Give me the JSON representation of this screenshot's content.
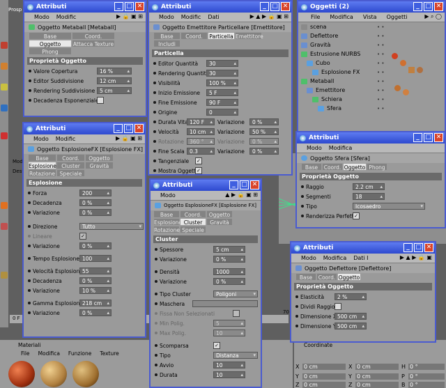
{
  "bg_labels": {
    "top_left": "Prosp",
    "mod": "Mod",
    "des": "Desti",
    "frame_field": "0 F",
    "frame_num": "70"
  },
  "materials": {
    "title": "Materiali",
    "menu": [
      "File",
      "Modifica",
      "Funzione",
      "Texture"
    ]
  },
  "coordinates": {
    "title": "Coordinate",
    "rows": [
      {
        "a": "X",
        "av": "0 cm",
        "b": "X",
        "bv": "0 cm",
        "c": "H",
        "cv": "0 °"
      },
      {
        "a": "Y",
        "av": "0 cm",
        "b": "Y",
        "bv": "0 cm",
        "c": "P",
        "cv": "0 °"
      },
      {
        "a": "Z",
        "av": "0 cm",
        "b": "Z",
        "bv": "0 cm",
        "c": "B",
        "cv": "0 °"
      }
    ]
  },
  "w1": {
    "title": "Attributi",
    "menu": [
      "Modo",
      "Modific"
    ],
    "object": "Oggetto Metaball [Metaball]",
    "tabs": [
      "Base",
      "Coord.",
      "Oggetto",
      "Attacca Texture",
      "Phong"
    ],
    "section": "Proprietà Oggetto",
    "rows": [
      {
        "label": "Valore Copertura",
        "value": "16 %"
      },
      {
        "label": "Editor Suddivisione",
        "value": "12 cm"
      },
      {
        "label": "Rendering Suddivisione",
        "value": "5 cm"
      },
      {
        "label": "Decadenza Esponenziale"
      }
    ]
  },
  "w2": {
    "title": "Attributi",
    "menu": [
      "Modo",
      "Modific",
      "Dati"
    ],
    "object": "Oggetto Emettitore Particellare [Emettitore]",
    "tabs": [
      "Base",
      "Coord.",
      "Particella",
      "Emettitore",
      "Includi"
    ],
    "section": "Particella",
    "rows": [
      {
        "label": "Editor Quantità",
        "value": "30"
      },
      {
        "label": "Rendering Quantità",
        "value": "30"
      },
      {
        "label": "Visibilità",
        "value": "100 %"
      },
      {
        "label": "Inizio Emissione",
        "value": "5 F"
      },
      {
        "label": "Fine Emissione",
        "value": "90 F"
      },
      {
        "label": "Origine",
        "value": "0"
      },
      {
        "label": "Durata Vita",
        "value": "120 F",
        "label2": "Variazione",
        "value2": "0 %"
      },
      {
        "label": "Velocità",
        "value": "10 cm",
        "label2": "Variazione",
        "value2": "50 %"
      },
      {
        "label": "Rotazione",
        "value": "360 °",
        "label2": "Variazione",
        "value2": "0 %"
      },
      {
        "label": "Fine Scala",
        "value": "0.3",
        "label2": "Variazione",
        "value2": "0 %"
      },
      {
        "label": "Tangenziale"
      },
      {
        "label": "Mostra Oggetti"
      }
    ]
  },
  "w3": {
    "title": "Oggetti (2)",
    "menu": [
      "File",
      "Modifica",
      "Vista",
      "Oggetti"
    ],
    "items": [
      "scena",
      "Deflettore",
      "Gravità",
      "Estrusione NURBS",
      "Cubo",
      "Esplosione FX",
      "Metaball",
      "Emettitore",
      "Schiera",
      "Sfera"
    ]
  },
  "w4": {
    "title": "Attributi",
    "menu": [
      "Modo",
      "Modific"
    ],
    "object": "Oggetto EsplosioneFX [Esplosione FX]",
    "tabs": [
      "Base",
      "Coord.",
      "Oggetto",
      "Esplosione",
      "Cluster",
      "Gravità",
      "Rotazione",
      "Speciale"
    ],
    "section": "Esplosione",
    "rows": [
      {
        "label": "Forza",
        "value": "200"
      },
      {
        "label": "Decadenza",
        "value": "0 %"
      },
      {
        "label": "Variazione",
        "value": "0 %"
      },
      {
        "label": "Direzione",
        "value": "Tutto"
      },
      {
        "label": "Lineare"
      },
      {
        "label": "Variazione",
        "value": "0 %"
      },
      {
        "label": "Tempo Esplosione",
        "value": "100"
      },
      {
        "label": "Velocità Esplosione",
        "value": "55"
      },
      {
        "label": "Decadenza",
        "value": "0 %"
      },
      {
        "label": "Variazione",
        "value": "10 %"
      },
      {
        "label": "Gamma Esplosione",
        "value": "218 cm"
      },
      {
        "label": "Variazione",
        "value": "0 %"
      }
    ]
  },
  "w5": {
    "title": "Attributi",
    "menu": [
      "Modo"
    ],
    "object": "Oggetto EsplosioneFX [Esplosione FX]",
    "tabs": [
      "Base",
      "Coord.",
      "Oggetto",
      "Esplosione",
      "Cluster",
      "Gravità",
      "Rotazione",
      "Speciale"
    ],
    "section": "Cluster",
    "rows": [
      {
        "label": "Spessore",
        "value": "5 cm"
      },
      {
        "label": "Variazione",
        "value": "0 %"
      },
      {
        "label": "Densità",
        "value": "1000"
      },
      {
        "label": "Variazione",
        "value": "0 %"
      },
      {
        "label": "Tipo Cluster",
        "value": "Poligoni"
      },
      {
        "label": "Maschera"
      },
      {
        "label": "Fissa Non Selezionati"
      },
      {
        "label": "Min Polig.",
        "value": "5"
      },
      {
        "label": "Max Polig.",
        "value": "10"
      },
      {
        "label": "Scomparsa"
      },
      {
        "label": "Tipo",
        "value": "Distanza"
      },
      {
        "label": "Avvio",
        "value": "10"
      },
      {
        "label": "Durata",
        "value": "10"
      }
    ]
  },
  "w6": {
    "title": "Attributi",
    "menu": [
      "Modo",
      "Modifica"
    ],
    "object": "Oggetto Sfera [Sfera]",
    "tabs": [
      "Base",
      "Coord.",
      "Oggetto",
      "Phong"
    ],
    "section": "Proprietà Oggetto",
    "rows": [
      {
        "label": "Raggio",
        "value": "2.2 cm"
      },
      {
        "label": "Segmenti",
        "value": "18"
      },
      {
        "label": "Tipo",
        "value": "Icosaedro"
      },
      {
        "label": "Renderizza Perfetto"
      }
    ]
  },
  "w7": {
    "title": "Attributi",
    "menu": [
      "Modo",
      "Modifica",
      "Dati I"
    ],
    "object": "Oggetto Deflettore [Deflettore]",
    "tabs": [
      "Base",
      "Coord.",
      "Oggetto"
    ],
    "section": "Proprietà Oggetto",
    "rows": [
      {
        "label": "Elasticità",
        "value": "2 %"
      },
      {
        "label": "Dividi Raggio"
      },
      {
        "label": "Dimensione X",
        "value": "500 cm"
      },
      {
        "label": "Dimensione Y",
        "value": "500 cm"
      }
    ]
  }
}
